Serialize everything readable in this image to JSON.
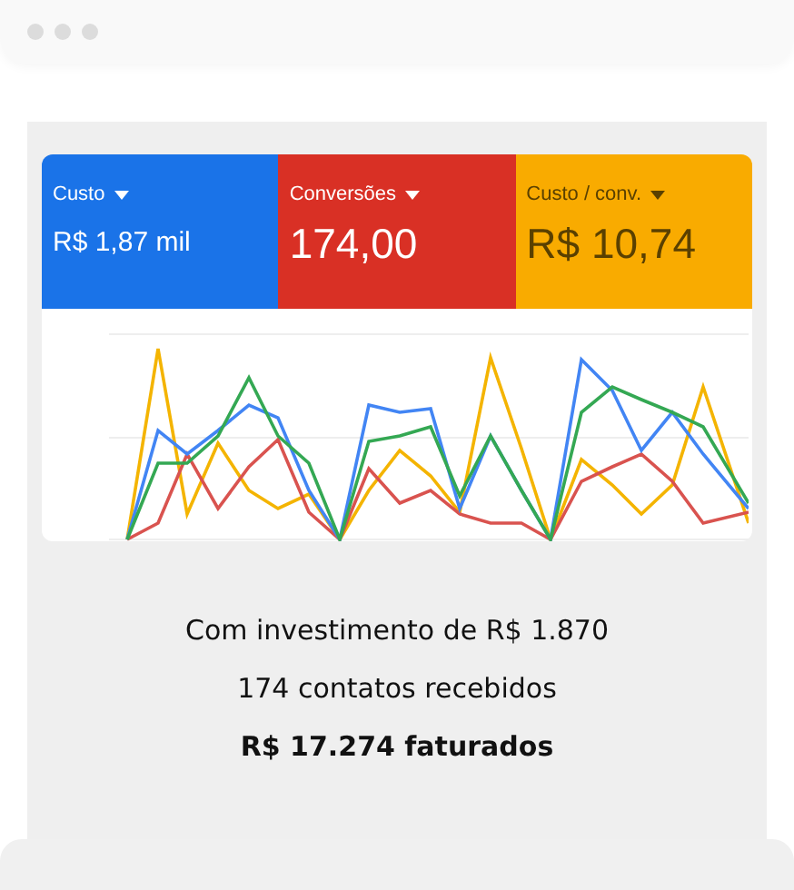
{
  "metrics": [
    {
      "label": "Custo",
      "value": "R$ 1,87 mil",
      "color": "#1a73e8",
      "kind": "compact"
    },
    {
      "label": "Conversões",
      "value": "174,00",
      "color": "#d93025",
      "kind": "large"
    },
    {
      "label": "Custo / conv.",
      "value": "R$ 10,74",
      "color": "#f9ab00",
      "kind": "large"
    }
  ],
  "summary": [
    {
      "text": "Com investimento de R$ 1.870",
      "kind": "regular"
    },
    {
      "text": "174 contatos recebidos",
      "kind": "regular"
    },
    {
      "text": "R$ 17.274 faturados",
      "kind": "strong"
    }
  ]
}
